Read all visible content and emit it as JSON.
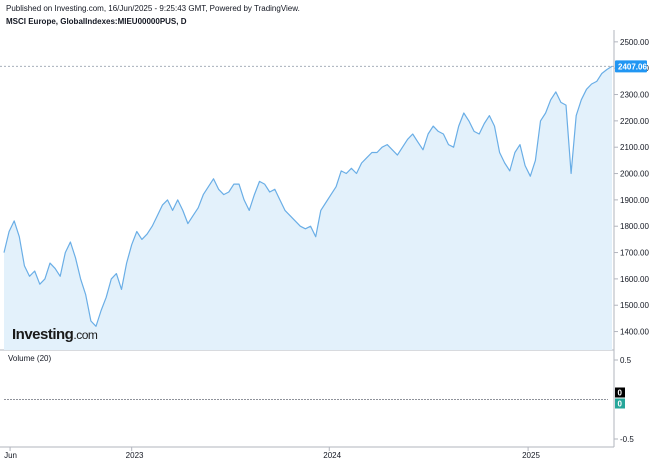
{
  "header": {
    "published": "Published on Investing.com, 16/Jun/2025 - 9:25:43 GMT, Powered by TradingView.",
    "symbol": "MSCI Europe, GlobalIndexes:MIEU00000PUS, D"
  },
  "logo": {
    "brand": "Investing",
    "suffix": ".com"
  },
  "colors": {
    "line": "#6aaee6",
    "fill": "#e3f1fb",
    "badge": "#2196f3",
    "axis": "#787b86",
    "grid_dash": "#9aa4b1"
  },
  "chart_data": {
    "type": "area",
    "y_ticks": [
      1400,
      1500,
      1600,
      1700,
      1800,
      1900,
      2000,
      2100,
      2200,
      2300,
      2400,
      2500
    ],
    "y_tick_labels": [
      "1400.00",
      "1500.00",
      "1600.00",
      "1700.00",
      "1800.00",
      "1900.00",
      "2000.00",
      "2100.00",
      "2200.00",
      "2300.00",
      "2400.00",
      "2500.00"
    ],
    "ylim": [
      1330,
      2545
    ],
    "x_tick_labels": [
      {
        "label": "Jun",
        "t": 0.01
      },
      {
        "label": "2023",
        "t": 0.21
      },
      {
        "label": "2024",
        "t": 0.535
      },
      {
        "label": "2025",
        "t": 0.862
      }
    ],
    "last_value": 2407.06,
    "last_value_label": "2407.06",
    "values": [
      1700,
      1780,
      1820,
      1760,
      1650,
      1610,
      1630,
      1580,
      1600,
      1660,
      1640,
      1610,
      1700,
      1740,
      1680,
      1600,
      1540,
      1440,
      1420,
      1480,
      1530,
      1600,
      1620,
      1560,
      1660,
      1730,
      1780,
      1750,
      1770,
      1800,
      1840,
      1880,
      1900,
      1860,
      1900,
      1860,
      1810,
      1840,
      1870,
      1920,
      1950,
      1980,
      1940,
      1920,
      1930,
      1960,
      1960,
      1900,
      1860,
      1920,
      1970,
      1960,
      1930,
      1940,
      1900,
      1860,
      1840,
      1820,
      1800,
      1790,
      1800,
      1760,
      1860,
      1890,
      1920,
      1950,
      2010,
      2000,
      2020,
      2000,
      2040,
      2060,
      2080,
      2080,
      2100,
      2110,
      2090,
      2070,
      2100,
      2130,
      2150,
      2120,
      2090,
      2150,
      2180,
      2160,
      2150,
      2110,
      2100,
      2180,
      2230,
      2200,
      2160,
      2150,
      2190,
      2220,
      2180,
      2080,
      2040,
      2010,
      2080,
      2110,
      2030,
      1990,
      2050,
      2200,
      2230,
      2280,
      2310,
      2270,
      2260,
      2000,
      2220,
      2280,
      2320,
      2340,
      2350,
      2380,
      2395,
      2407
    ],
    "volume_axis": [
      0.5,
      0,
      -0.5
    ],
    "volume_axis_labels": [
      "0.5",
      "0",
      "-0.5"
    ],
    "volume": {
      "label": "Volume (20)",
      "value_a": 0,
      "value_b": 0,
      "value_a_label": "0",
      "value_b_label": "0",
      "badge_a_color": "#000000",
      "badge_b_color": "#26a69a"
    }
  }
}
